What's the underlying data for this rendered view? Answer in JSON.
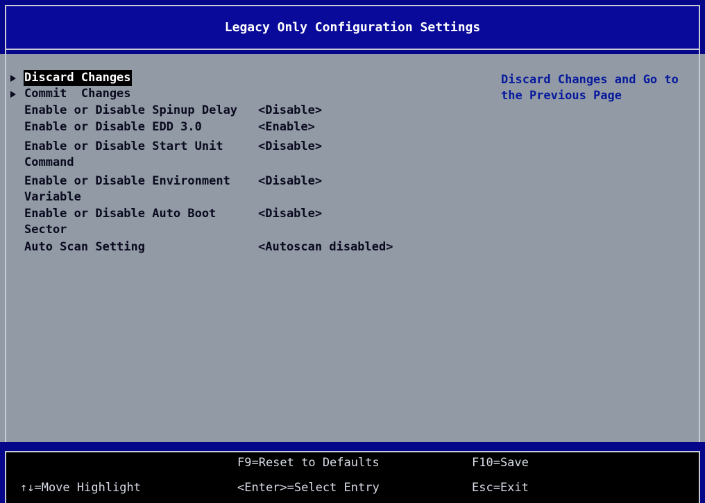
{
  "header": {
    "title": "Legacy Only Configuration Settings"
  },
  "menu": {
    "items": [
      {
        "label": "Discard Changes",
        "value": ""
      },
      {
        "label": "Commit  Changes",
        "value": ""
      },
      {
        "label": "Enable or Disable Spinup Delay",
        "value": "<Disable>"
      },
      {
        "label": "Enable or Disable EDD 3.0",
        "value": "<Enable>"
      },
      {
        "label_line1": "Enable or Disable Start Unit",
        "label_line2": "Command",
        "value": "<Disable>"
      },
      {
        "label_line1": "Enable or Disable Environment",
        "label_line2": "Variable",
        "value": "<Disable>"
      },
      {
        "label_line1": "Enable or Disable Auto Boot",
        "label_line2": "Sector",
        "value": "<Disable>"
      },
      {
        "label": "Auto Scan Setting",
        "value": "<Autoscan disabled>"
      }
    ]
  },
  "help": {
    "line1": "Discard Changes and Go to",
    "line2": "the Previous Page"
  },
  "footer": {
    "move": "↑↓=Move Highlight",
    "reset": "F9=Reset to Defaults",
    "select": "<Enter>=Select Entry",
    "save": "F10=Save",
    "exit": "Esc=Exit"
  },
  "colors": {
    "background": "#929aa6",
    "bar": "#06068a",
    "highlight": "#000000",
    "help_text": "#061a9c"
  },
  "icons": {
    "submenu": "right-triangle-icon"
  }
}
